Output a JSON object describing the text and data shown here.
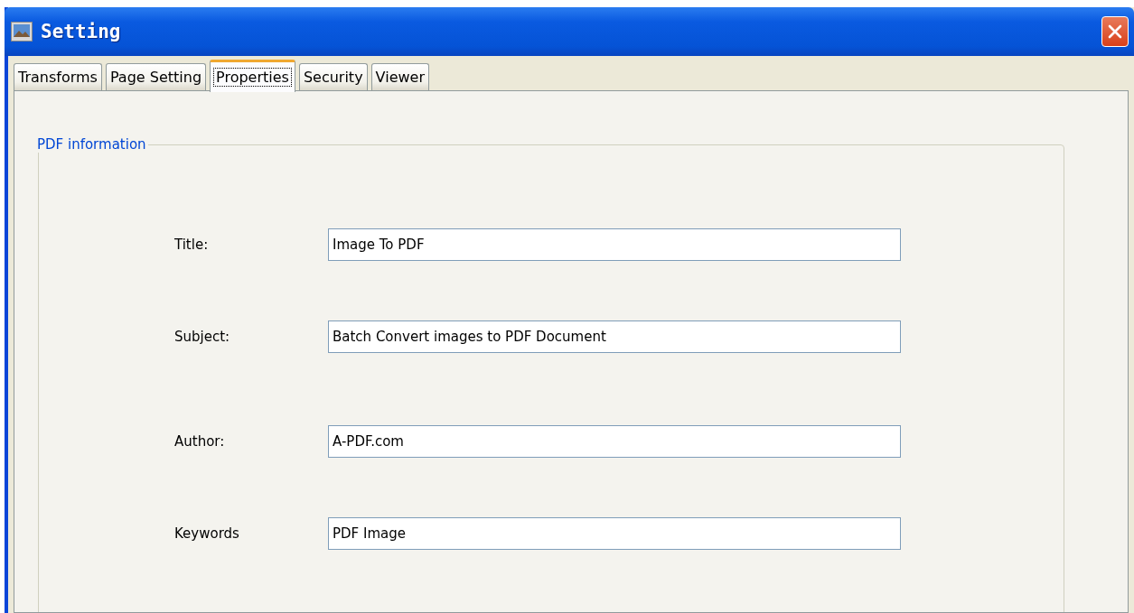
{
  "window": {
    "title": "Setting"
  },
  "tabs": [
    {
      "label": "Transforms",
      "selected": false
    },
    {
      "label": "Page Setting",
      "selected": false
    },
    {
      "label": "Properties",
      "selected": true
    },
    {
      "label": "Security",
      "selected": false
    },
    {
      "label": "Viewer",
      "selected": false
    }
  ],
  "group": {
    "title": "PDF information",
    "fields": [
      {
        "label": "Title:",
        "value": "Image To PDF"
      },
      {
        "label": "Subject:",
        "value": "Batch Convert images to PDF Document"
      },
      {
        "label": "Author:",
        "value": "A-PDF.com"
      },
      {
        "label": "Keywords",
        "value": "PDF Image"
      }
    ]
  }
}
